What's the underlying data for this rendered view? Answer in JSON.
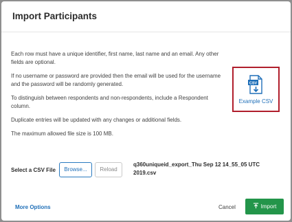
{
  "dialog": {
    "title": "Import Participants",
    "instructions": [
      "Each row must have a unique identifier, first name, last name and an email. Any other fields are optional.",
      "If no username or password are provided then the email will be used for the username and the password will be randomly generated.",
      "To distinguish between respondents and non-respondents, include a Respondent column.",
      "Duplicate entries will be updated with any changes or additional fields.",
      "The maximum allowed file size is 100 MB."
    ],
    "example": {
      "label": "Example CSV",
      "icon": "csv-file-download-icon",
      "icon_text": "CSV",
      "highlight_color": "#b01e2c"
    },
    "csv": {
      "label": "Select a CSV File",
      "browse_label": "Browse...",
      "reload_label": "Reload",
      "filename": "q360uniqueid_export_Thu Sep 12 14_55_05 UTC 2019.csv"
    },
    "footer": {
      "more_options": "More Options",
      "cancel": "Cancel",
      "import": "Import",
      "import_icon": "upload-icon",
      "accent": "#23954a"
    }
  }
}
